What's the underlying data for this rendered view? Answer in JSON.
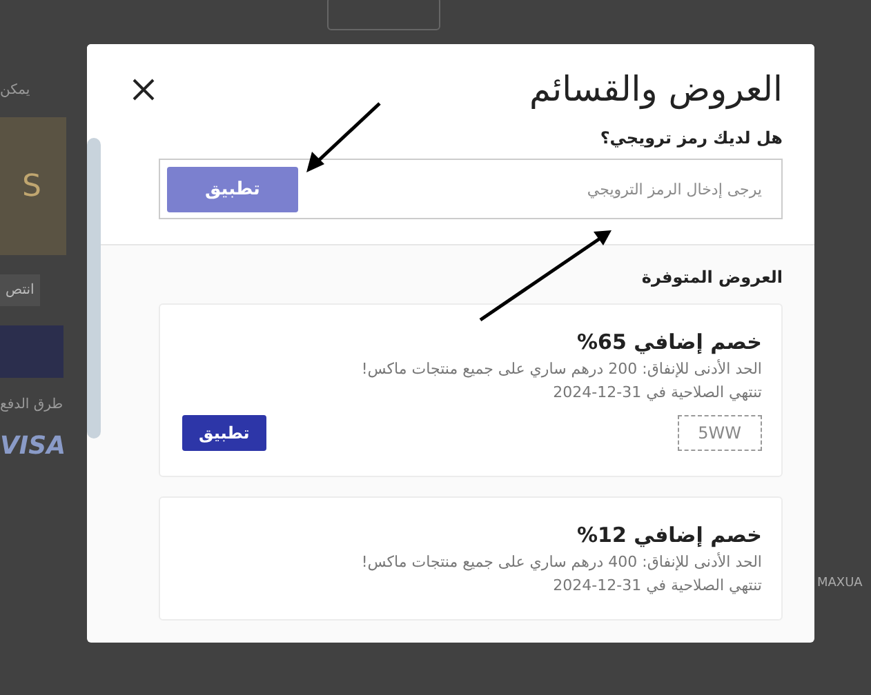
{
  "background": {
    "texts": [
      {
        "kind": "text",
        "text": "يمكن"
      },
      {
        "kind": "accent",
        "text": "S"
      },
      {
        "kind": "button",
        "text": "انتص"
      },
      {
        "kind": "bar"
      },
      {
        "kind": "text",
        "text": "طرق الدفع"
      },
      {
        "kind": "brand",
        "text": "VISA"
      }
    ],
    "side_text": "MAXUA"
  },
  "modal": {
    "title": "العروض والقسائم",
    "promo_label": "هل لديك رمز ترويجي؟",
    "promo_placeholder": "يرجى إدخال الرمز الترويجي",
    "promo_button": "تطبيق",
    "offers_heading": "العروض المتوفرة",
    "offers": [
      {
        "title": "خصم إضافي 65%",
        "description": "الحد الأدنى للإنفاق: 200 درهم ساري على جميع منتجات ماكس!",
        "expiry": "تنتهي الصلاحية في 31-12-2024",
        "code": "5WW",
        "button": "تطبيق"
      },
      {
        "title": "خصم إضافي 12%",
        "description": "الحد الأدنى للإنفاق: 400 درهم ساري على جميع منتجات ماكس!",
        "expiry": "تنتهي الصلاحية في 31-12-2024"
      }
    ]
  }
}
